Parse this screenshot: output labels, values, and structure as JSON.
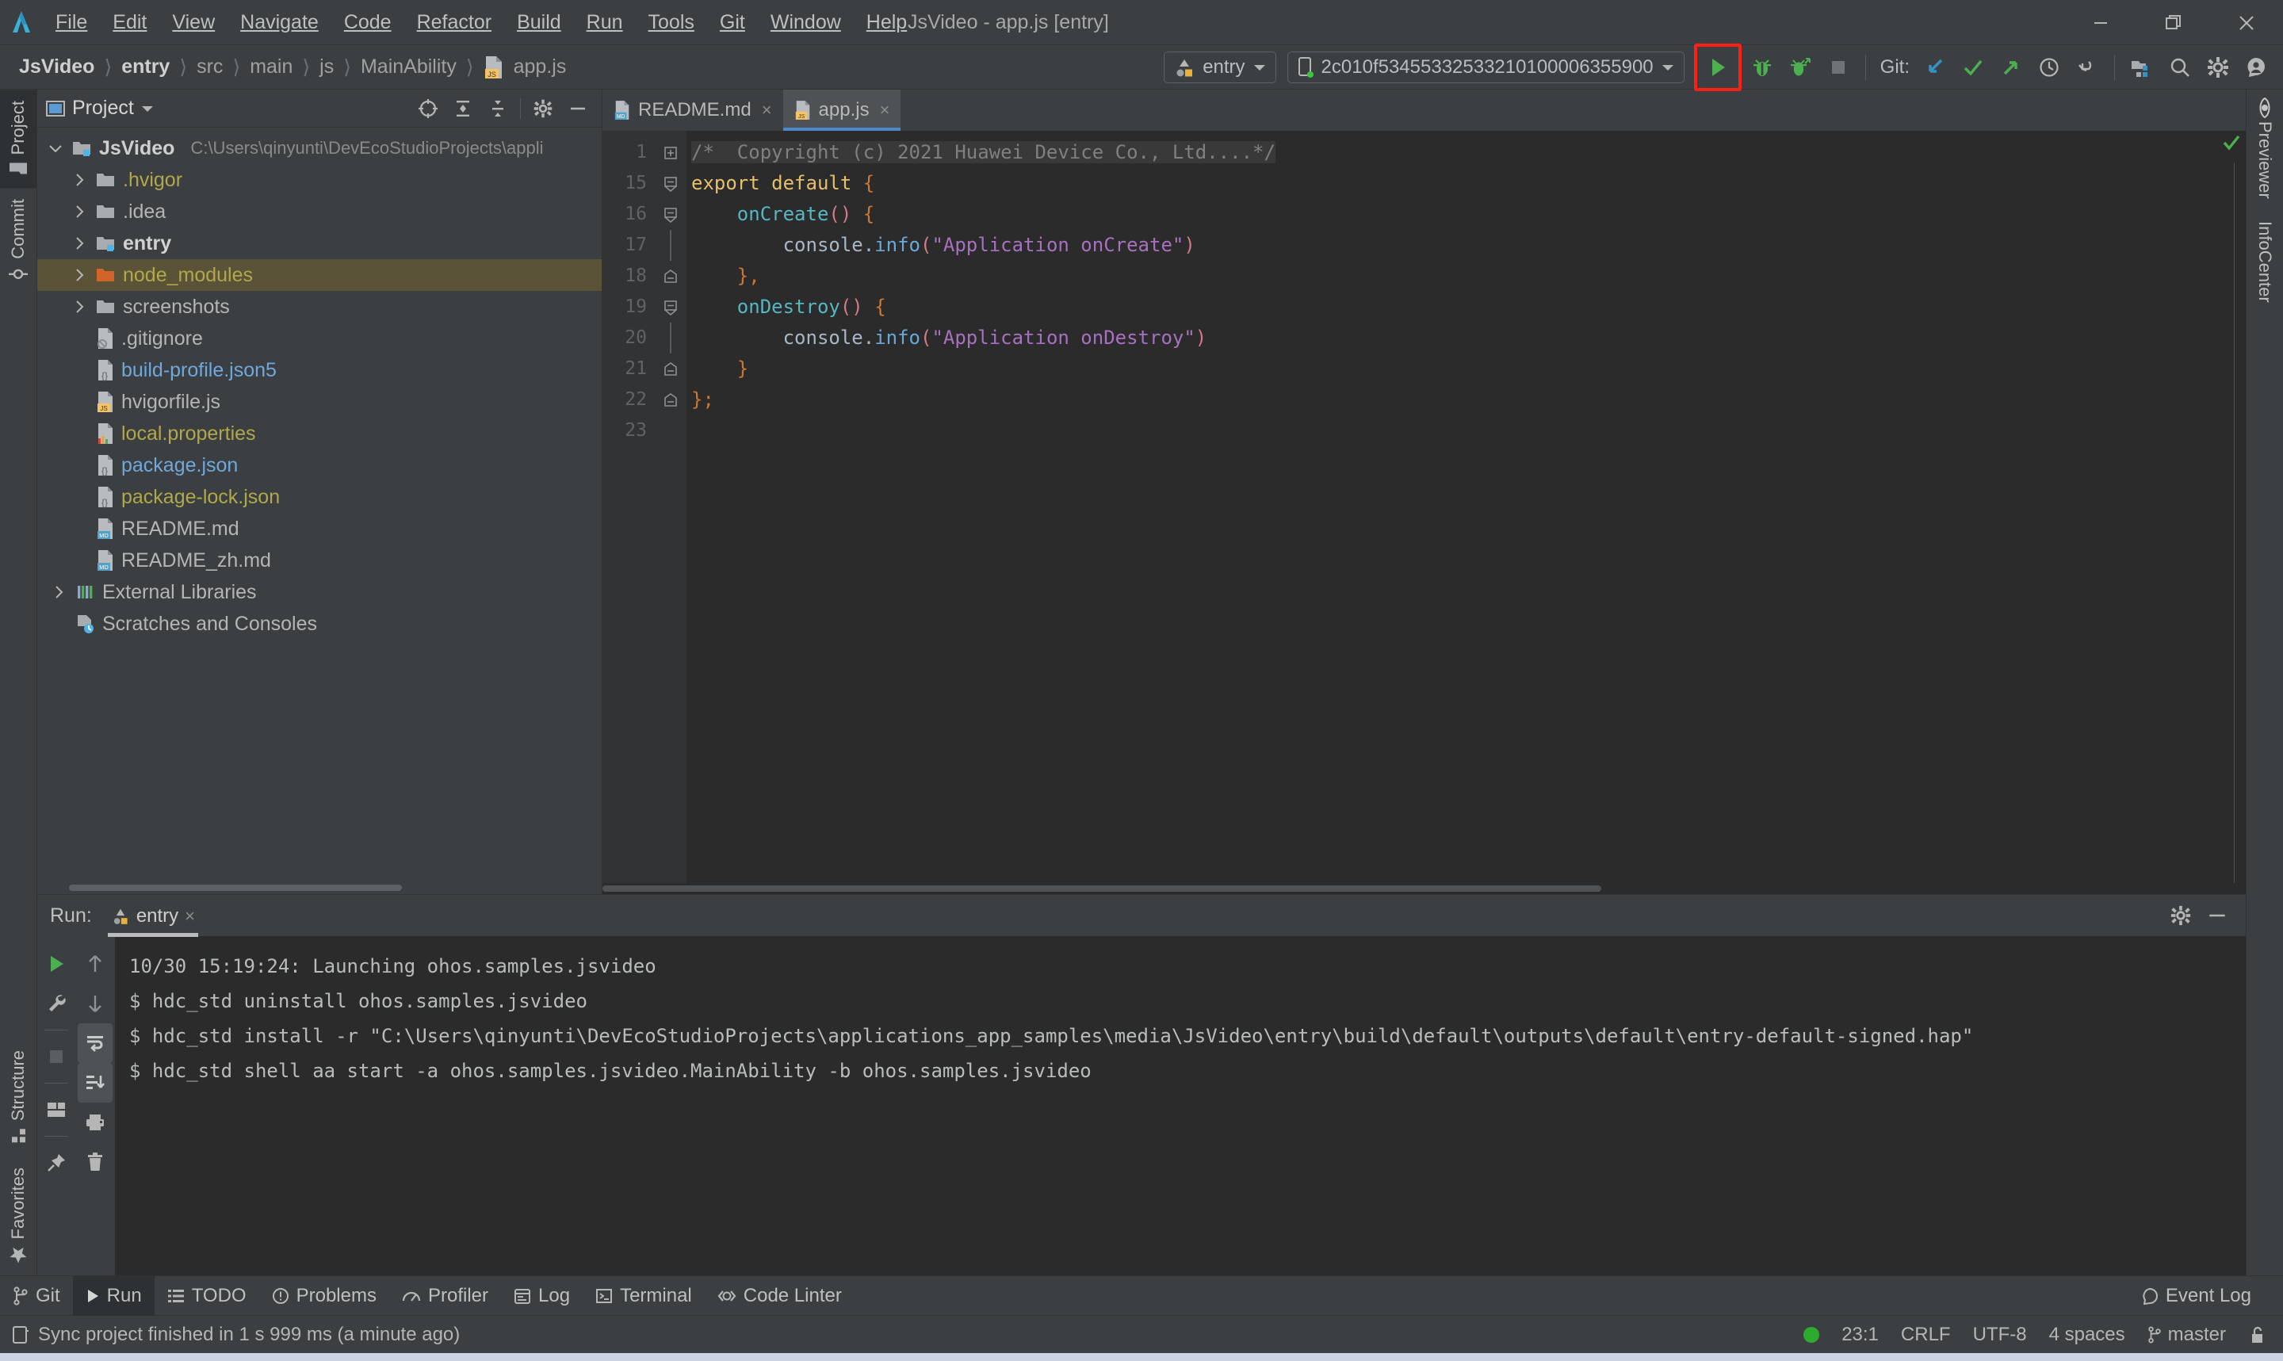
{
  "window": {
    "title": "JsVideo - app.js [entry]",
    "minimize_label": "Minimize",
    "restore_label": "Restore",
    "close_label": "Close"
  },
  "menubar": {
    "items": [
      {
        "label": "File"
      },
      {
        "label": "Edit"
      },
      {
        "label": "View"
      },
      {
        "label": "Navigate"
      },
      {
        "label": "Code"
      },
      {
        "label": "Refactor"
      },
      {
        "label": "Build"
      },
      {
        "label": "Run"
      },
      {
        "label": "Tools"
      },
      {
        "label": "Git"
      },
      {
        "label": "Window"
      },
      {
        "label": "Help"
      }
    ]
  },
  "breadcrumb": {
    "items": [
      "JsVideo",
      "entry",
      "src",
      "main",
      "js",
      "MainAbility",
      "app.js"
    ],
    "separator": "〉"
  },
  "toolbar": {
    "run_config": "entry",
    "device": "2c010f53455332533210100006355900",
    "git_label": "Git:",
    "run_button": "Run",
    "debug_button": "Debug",
    "profile_button": "Profile",
    "stop_button": "Stop",
    "update_project_button": "Update Project",
    "commit_button": "Commit",
    "push_button": "Push",
    "history_button": "History",
    "rollback_button": "Rollback",
    "structure_button": "Project Structure",
    "search_button": "Search Everywhere",
    "settings_button": "Settings",
    "account_button": "Account",
    "highlight_color": "#ff2015"
  },
  "left_rail": {
    "tabs": [
      {
        "label": "Project",
        "icon": "folder-icon",
        "active": true
      },
      {
        "label": "Commit",
        "icon": "commit-icon",
        "active": false
      }
    ],
    "bottom_tabs": [
      {
        "label": "Structure",
        "icon": "structure-icon"
      },
      {
        "label": "Favorites",
        "icon": "star-icon"
      }
    ]
  },
  "right_rail": {
    "tabs": [
      {
        "label": "Previewer",
        "icon": "eye-icon"
      },
      {
        "label": "InfoCenter",
        "icon": "info-icon"
      }
    ]
  },
  "project_panel": {
    "title": "Project",
    "tools": [
      {
        "name": "locate-icon",
        "label": "Select Opened File"
      },
      {
        "name": "expand-all-icon",
        "label": "Expand All"
      },
      {
        "name": "collapse-all-icon",
        "label": "Collapse All"
      },
      {
        "name": "gear-icon",
        "label": "Options"
      },
      {
        "name": "hide-icon",
        "label": "Hide"
      }
    ],
    "tree": [
      {
        "label": "JsVideo",
        "path": "C:\\Users\\qinyunti\\DevEcoStudioProjects\\appli",
        "icon": "module-folder-icon",
        "indent": 0,
        "twist": "down",
        "bold": true,
        "color": "#cfcfcf",
        "selected": false
      },
      {
        "label": ".hvigor",
        "path": "",
        "icon": "folder-icon",
        "indent": 1,
        "twist": "right",
        "bold": false,
        "color": "#b0a84a",
        "selected": false
      },
      {
        "label": ".idea",
        "path": "",
        "icon": "folder-icon",
        "indent": 1,
        "twist": "right",
        "bold": false,
        "color": "#b5b5b5",
        "selected": false
      },
      {
        "label": "entry",
        "path": "",
        "icon": "module-folder-icon",
        "indent": 1,
        "twist": "right",
        "bold": true,
        "color": "#cfcfcf",
        "selected": false
      },
      {
        "label": "node_modules",
        "path": "",
        "icon": "orange-folder-icon",
        "indent": 1,
        "twist": "right",
        "bold": false,
        "color": "#b0a84a",
        "selected": true
      },
      {
        "label": "screenshots",
        "path": "",
        "icon": "folder-icon",
        "indent": 1,
        "twist": "right",
        "bold": false,
        "color": "#b5b5b5",
        "selected": false
      },
      {
        "label": ".gitignore",
        "path": "",
        "icon": "gitignore-file-icon",
        "indent": 2,
        "twist": "none",
        "bold": false,
        "color": "#b5b5b5",
        "selected": false
      },
      {
        "label": "build-profile.json5",
        "path": "",
        "icon": "json-file-icon",
        "indent": 2,
        "twist": "none",
        "bold": false,
        "color": "#6fa8dc",
        "selected": false
      },
      {
        "label": "hvigorfile.js",
        "path": "",
        "icon": "js-file-icon",
        "indent": 2,
        "twist": "none",
        "bold": false,
        "color": "#b5b5b5",
        "selected": false
      },
      {
        "label": "local.properties",
        "path": "",
        "icon": "properties-file-icon",
        "indent": 2,
        "twist": "none",
        "bold": false,
        "color": "#b0a84a",
        "selected": false
      },
      {
        "label": "package.json",
        "path": "",
        "icon": "json-file-icon",
        "indent": 2,
        "twist": "none",
        "bold": false,
        "color": "#6fa8dc",
        "selected": false
      },
      {
        "label": "package-lock.json",
        "path": "",
        "icon": "json-file-icon",
        "indent": 2,
        "twist": "none",
        "bold": false,
        "color": "#b0a84a",
        "selected": false
      },
      {
        "label": "README.md",
        "path": "",
        "icon": "md-file-icon",
        "indent": 2,
        "twist": "none",
        "bold": false,
        "color": "#b5b5b5",
        "selected": false
      },
      {
        "label": "README_zh.md",
        "path": "",
        "icon": "md-file-icon",
        "indent": 2,
        "twist": "none",
        "bold": false,
        "color": "#b5b5b5",
        "selected": false
      },
      {
        "label": "External Libraries",
        "path": "",
        "icon": "libraries-icon",
        "indent": 0,
        "twist": "right",
        "bold": false,
        "color": "#b5b5b5",
        "selected": false
      },
      {
        "label": "Scratches and Consoles",
        "path": "",
        "icon": "scratches-icon",
        "indent": 0,
        "twist": "none",
        "bold": false,
        "color": "#b5b5b5",
        "selected": false
      }
    ]
  },
  "editor": {
    "tabs": [
      {
        "label": "README.md",
        "icon": "md-file-icon",
        "active": false
      },
      {
        "label": "app.js",
        "icon": "js-file-icon",
        "active": true
      }
    ],
    "close_glyph": "×",
    "line_numbers": [
      "1",
      "15",
      "16",
      "17",
      "18",
      "19",
      "20",
      "21",
      "22",
      "23"
    ],
    "lines": [
      {
        "num": "1",
        "fold": "plus",
        "tokens": [
          {
            "t": "/*  Copyright (c) 2021 Huawei Device Co., Ltd....*/",
            "c": "k-cmt"
          }
        ],
        "collapsed_highlight": true
      },
      {
        "num": "15",
        "fold": "open",
        "tokens": [
          {
            "t": "export default",
            "c": "k-kw2"
          },
          {
            "t": " ",
            "c": "k-id"
          },
          {
            "t": "{",
            "c": "k-punc"
          }
        ]
      },
      {
        "num": "16",
        "fold": "open",
        "tokens": [
          {
            "t": "    ",
            "c": "k-id"
          },
          {
            "t": "onCreate",
            "c": "k-fn"
          },
          {
            "t": "()",
            "c": "k-paren"
          },
          {
            "t": " ",
            "c": "k-id"
          },
          {
            "t": "{",
            "c": "k-punc"
          }
        ]
      },
      {
        "num": "17",
        "fold": "bar",
        "tokens": [
          {
            "t": "        ",
            "c": "k-id"
          },
          {
            "t": "console",
            "c": "k-id"
          },
          {
            "t": ".",
            "c": "k-id"
          },
          {
            "t": "info",
            "c": "k-prop"
          },
          {
            "t": "(",
            "c": "k-paren"
          },
          {
            "t": "\"Application onCreate\"",
            "c": "k-str"
          },
          {
            "t": ")",
            "c": "k-paren"
          }
        ]
      },
      {
        "num": "18",
        "fold": "close",
        "tokens": [
          {
            "t": "    ",
            "c": "k-id"
          },
          {
            "t": "},",
            "c": "k-punc"
          }
        ]
      },
      {
        "num": "19",
        "fold": "open",
        "tokens": [
          {
            "t": "    ",
            "c": "k-id"
          },
          {
            "t": "onDestroy",
            "c": "k-fn"
          },
          {
            "t": "()",
            "c": "k-paren"
          },
          {
            "t": " ",
            "c": "k-id"
          },
          {
            "t": "{",
            "c": "k-punc"
          }
        ]
      },
      {
        "num": "20",
        "fold": "bar",
        "tokens": [
          {
            "t": "        ",
            "c": "k-id"
          },
          {
            "t": "console",
            "c": "k-id"
          },
          {
            "t": ".",
            "c": "k-id"
          },
          {
            "t": "info",
            "c": "k-prop"
          },
          {
            "t": "(",
            "c": "k-paren"
          },
          {
            "t": "\"Application onDestroy\"",
            "c": "k-str"
          },
          {
            "t": ")",
            "c": "k-paren"
          }
        ]
      },
      {
        "num": "21",
        "fold": "close",
        "tokens": [
          {
            "t": "    ",
            "c": "k-id"
          },
          {
            "t": "}",
            "c": "k-punc"
          }
        ]
      },
      {
        "num": "22",
        "fold": "close",
        "tokens": [
          {
            "t": "};",
            "c": "k-punc"
          }
        ]
      },
      {
        "num": "23",
        "fold": "none",
        "tokens": [
          {
            "t": "",
            "c": "k-id"
          }
        ]
      }
    ]
  },
  "run_panel": {
    "label": "Run:",
    "tab": "entry",
    "close_glyph": "×",
    "tools": [
      {
        "name": "gear-icon",
        "label": "Settings"
      },
      {
        "name": "hide-icon",
        "label": "Hide"
      }
    ],
    "side_buttons": [
      {
        "name": "rerun-icon",
        "label": "Rerun"
      },
      {
        "name": "wrench-icon",
        "label": "Edit Configuration"
      },
      {
        "name": "stop-icon",
        "label": "Stop"
      },
      {
        "name": "layout-icon",
        "label": "Layout"
      },
      {
        "name": "pin-icon",
        "label": "Pin Tab"
      }
    ],
    "side_buttons2": [
      {
        "name": "arrow-up-icon",
        "label": "Up"
      },
      {
        "name": "arrow-down-icon",
        "label": "Down"
      },
      {
        "name": "soft-wrap-icon",
        "label": "Soft-Wrap"
      },
      {
        "name": "scroll-end-icon",
        "label": "Scroll to End"
      },
      {
        "name": "print-icon",
        "label": "Print"
      },
      {
        "name": "trash-icon",
        "label": "Clear All"
      }
    ],
    "console_lines": [
      "10/30 15:19:24: Launching ohos.samples.jsvideo",
      "$ hdc_std uninstall ohos.samples.jsvideo",
      "$ hdc_std install -r \"C:\\Users\\qinyunti\\DevEcoStudioProjects\\applications_app_samples\\media\\JsVideo\\entry\\build\\default\\outputs\\default\\entry-default-signed.hap\"",
      "$ hdc_std shell aa start -a ohos.samples.jsvideo.MainAbility -b ohos.samples.jsvideo"
    ]
  },
  "tool_buttons": {
    "left": [
      {
        "label": "Git",
        "icon": "branch-icon",
        "active": false
      },
      {
        "label": "Run",
        "icon": "play-icon",
        "active": true
      },
      {
        "label": "TODO",
        "icon": "todo-icon",
        "active": false
      },
      {
        "label": "Problems",
        "icon": "problems-icon",
        "active": false
      },
      {
        "label": "Profiler",
        "icon": "profiler-icon",
        "active": false
      },
      {
        "label": "Log",
        "icon": "log-icon",
        "active": false
      },
      {
        "label": "Terminal",
        "icon": "terminal-icon",
        "active": false
      },
      {
        "label": "Code Linter",
        "icon": "linter-icon",
        "active": false
      }
    ],
    "right": [
      {
        "label": "Event Log",
        "icon": "event-log-icon",
        "active": false
      }
    ]
  },
  "statusbar": {
    "message": "Sync project finished in 1 s 999 ms (a minute ago)",
    "message_icon": "ide-icon",
    "caret": "23:1",
    "line_separator": "CRLF",
    "encoding": "UTF-8",
    "indent": "4 spaces",
    "branch": "master",
    "branch_icon": "branch-icon",
    "lock_icon": "lock-open-icon",
    "inspection_status": "ok",
    "inspection_color": "#2eab2e"
  }
}
